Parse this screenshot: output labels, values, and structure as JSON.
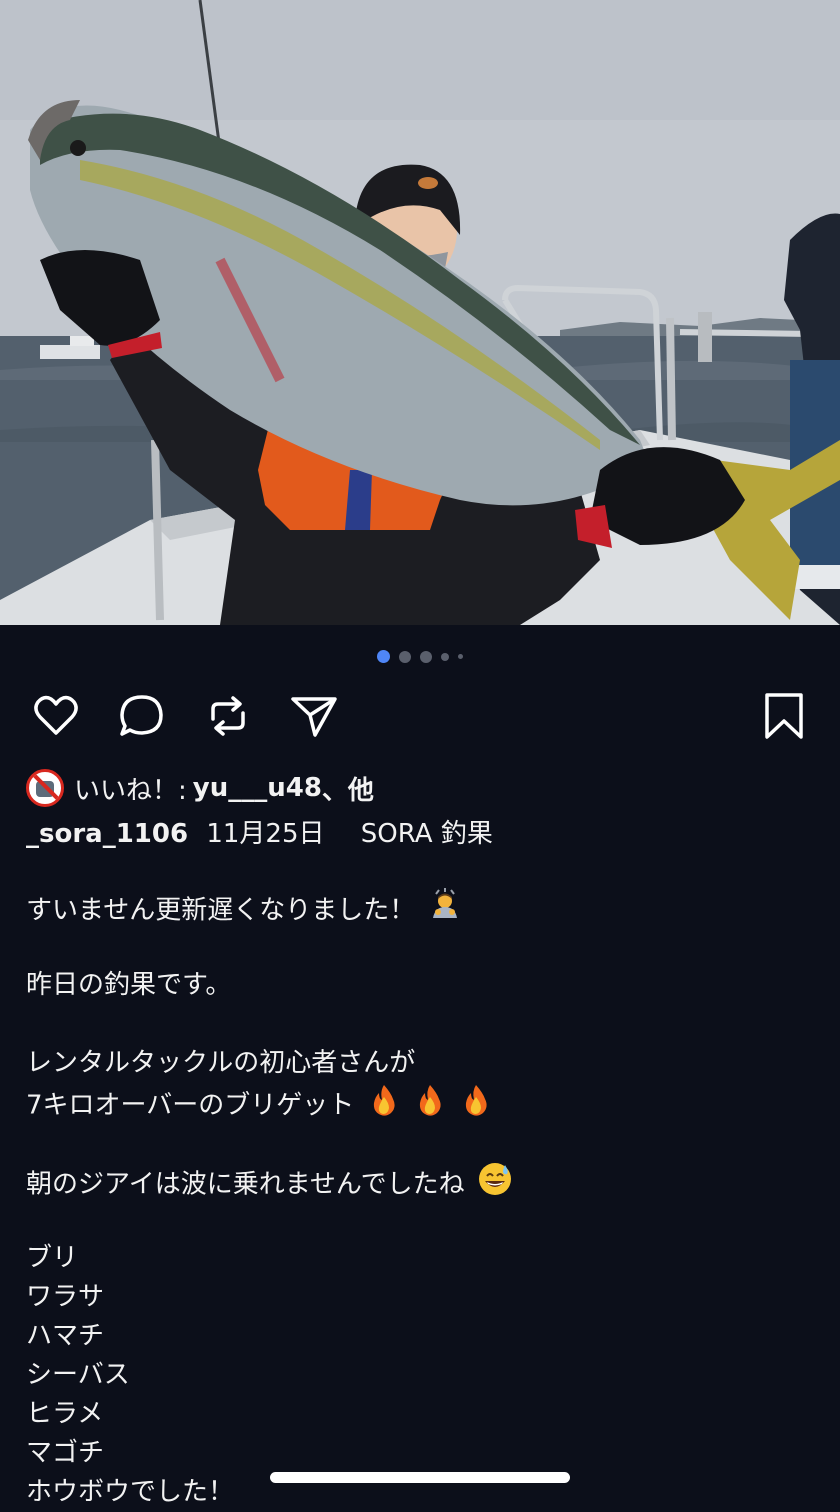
{
  "carousel": {
    "total": 5,
    "active": 0,
    "active_color": "#4f86f7"
  },
  "actions": {
    "like_icon": "heart-icon",
    "comment_icon": "comment-icon",
    "repost_icon": "repost-icon",
    "share_icon": "send-icon",
    "save_icon": "bookmark-icon"
  },
  "likes": {
    "prefix": "いいね！:",
    "user": "yu___u48",
    "suffix": "、他"
  },
  "post": {
    "author": "_sora_1106",
    "date": "11月25日",
    "location": "SORA 釣果"
  },
  "caption": {
    "line1": "すいません更新遅くなりました！",
    "line2": "昨日の釣果です。",
    "line3": "レンタルタックルの初心者さんが",
    "line4": "7キロオーバーのブリゲット",
    "line5": "朝のジアイは波に乗れませんでしたね",
    "species": [
      "ブリ",
      "ワラサ",
      "ハマチ",
      "シーバス",
      "ヒラメ",
      "マゴチ",
      "ホウボウでした！"
    ]
  }
}
